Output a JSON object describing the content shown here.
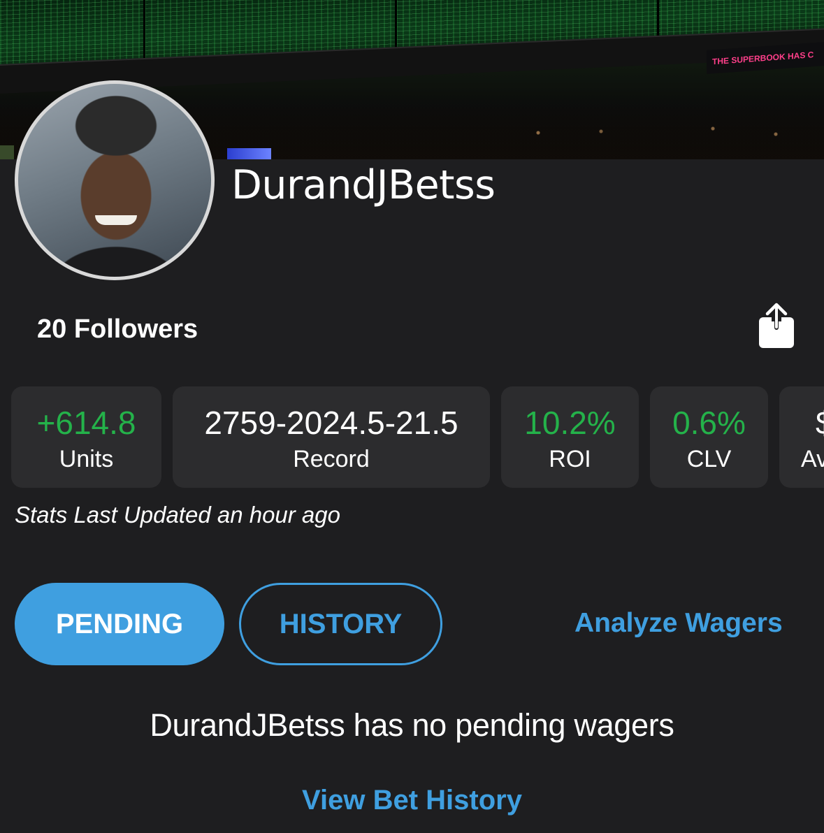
{
  "profile": {
    "username": "DurandJBetss",
    "followers_label": "20 Followers"
  },
  "banner": {
    "superbook_text": "THE SUPERBOOK HAS C"
  },
  "stats": [
    {
      "value": "+614.8",
      "label": "Units",
      "value_color": "#24b24a"
    },
    {
      "value": "2759-2024.5-21.5",
      "label": "Record",
      "value_color": "#ffffff"
    },
    {
      "value": "10.2%",
      "label": "ROI",
      "value_color": "#24b24a"
    },
    {
      "value": "0.6%",
      "label": "CLV",
      "value_color": "#24b24a"
    },
    {
      "value": "$",
      "label": "Av",
      "value_color": "#ffffff"
    }
  ],
  "stats_updated": "Stats Last Updated an hour ago",
  "tabs": {
    "pending_label": "PENDING",
    "history_label": "HISTORY",
    "analyze_label": "Analyze Wagers"
  },
  "pending": {
    "empty_message": "DurandJBetss has no pending wagers",
    "view_history_label": "View Bet History"
  },
  "colors": {
    "accent": "#3f9fe0",
    "positive": "#24b24a",
    "background": "#1e1e20",
    "card": "#2c2c2e"
  },
  "icons": {
    "share": "share-icon"
  }
}
